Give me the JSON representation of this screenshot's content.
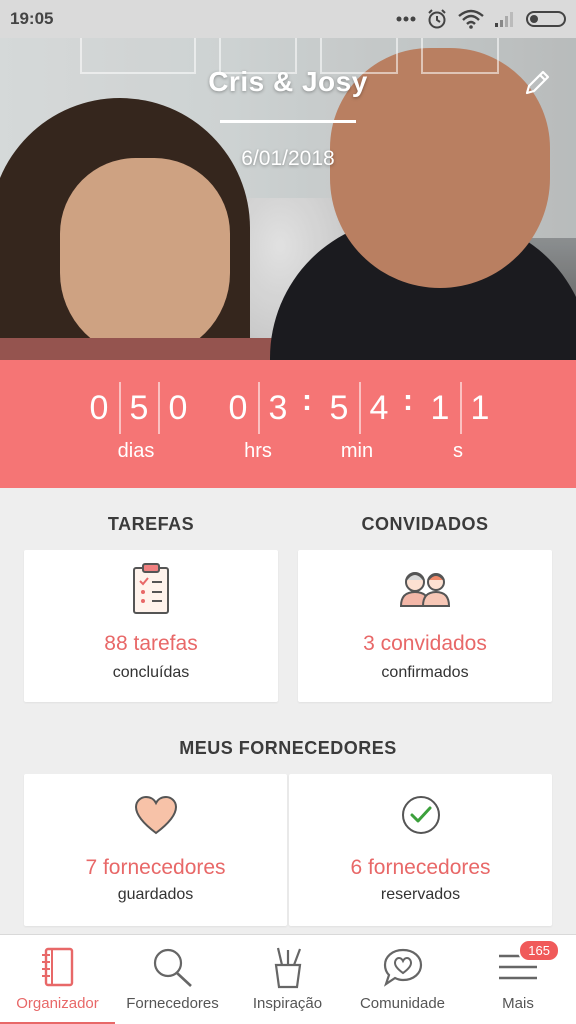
{
  "statusbar": {
    "time": "19:05"
  },
  "hero": {
    "couple_name": "Cris & Josy",
    "date": "6/01/2018"
  },
  "countdown": {
    "days": [
      "0",
      "5",
      "0"
    ],
    "hours": [
      "0",
      "3"
    ],
    "minutes": [
      "5",
      "4"
    ],
    "seconds": [
      "1",
      "1"
    ],
    "labels": {
      "days": "dias",
      "hours": "hrs",
      "minutes": "min",
      "seconds": "s"
    }
  },
  "tasks": {
    "title": "TAREFAS",
    "count": "88 tarefas",
    "sub": "concluídas"
  },
  "guests": {
    "title": "CONVIDADOS",
    "count": "3 convidados",
    "sub": "confirmados"
  },
  "vendors": {
    "title": "MEUS FORNECEDORES",
    "saved": {
      "count": "7 fornecedores",
      "sub": "guardados"
    },
    "booked": {
      "count": "6 fornecedores",
      "sub": "reservados"
    }
  },
  "nav": {
    "items": [
      {
        "label": "Organizador",
        "icon": "notebook-icon"
      },
      {
        "label": "Fornecedores",
        "icon": "search-icon"
      },
      {
        "label": "Inspiração",
        "icon": "pencil-cup-icon"
      },
      {
        "label": "Comunidade",
        "icon": "chat-heart-icon"
      },
      {
        "label": "Mais",
        "icon": "menu-icon",
        "badge": "165"
      }
    ]
  },
  "colors": {
    "accent": "#f57575",
    "accent_text": "#e86868"
  }
}
